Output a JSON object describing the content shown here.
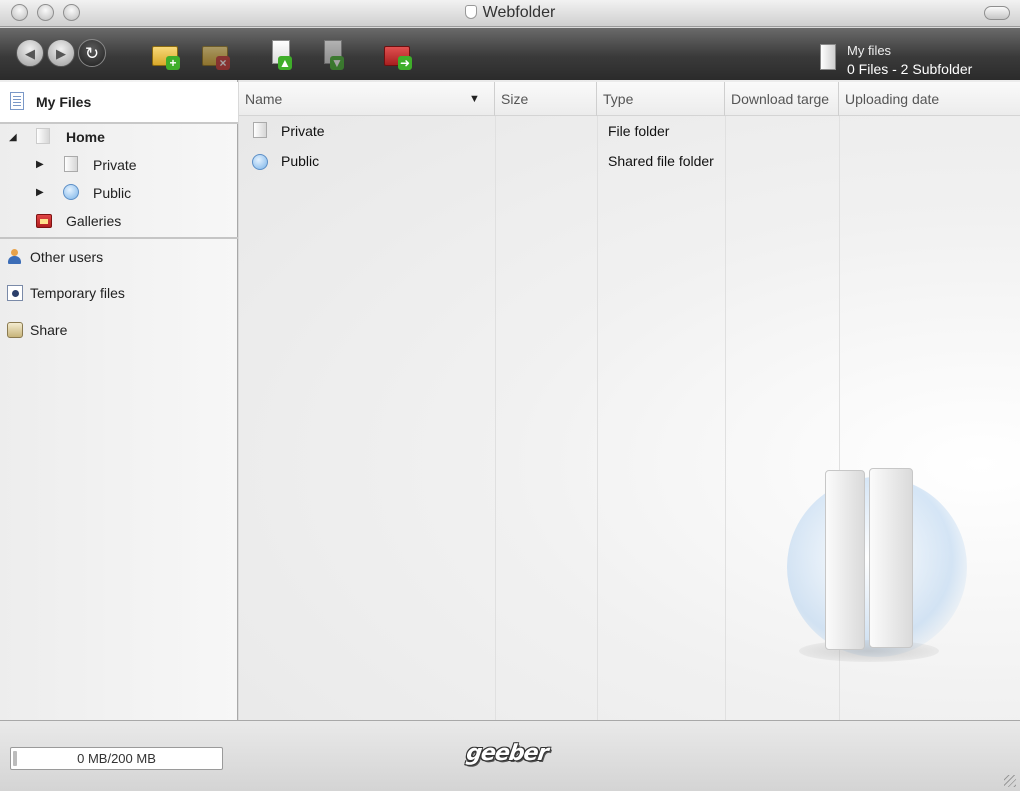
{
  "window": {
    "title": "Webfolder"
  },
  "toolbar": {
    "info_title": "My files",
    "info_subtitle": "0 Files - 2 Subfolder"
  },
  "sidebar": {
    "header": "My Files",
    "tree": [
      {
        "label": "Home"
      },
      {
        "label": "Private"
      },
      {
        "label": "Public"
      },
      {
        "label": "Galleries"
      }
    ],
    "sections": [
      {
        "label": "Other users"
      },
      {
        "label": "Temporary files"
      },
      {
        "label": "Share"
      }
    ]
  },
  "list": {
    "columns": [
      "Name",
      "Size",
      "Type",
      "Download targe",
      "Uploading date"
    ],
    "rows": [
      {
        "name": "Private",
        "size": "",
        "type": "File folder"
      },
      {
        "name": "Public",
        "size": "",
        "type": "Shared file folder"
      }
    ]
  },
  "footer": {
    "quota": "0 MB/200 MB",
    "quota_used_fraction": 0,
    "logo": "geeber"
  },
  "colors": {
    "toolbar_dark": "#2b2b2b",
    "upload_green": "#3fae2a",
    "delete_red": "#c9302c"
  }
}
